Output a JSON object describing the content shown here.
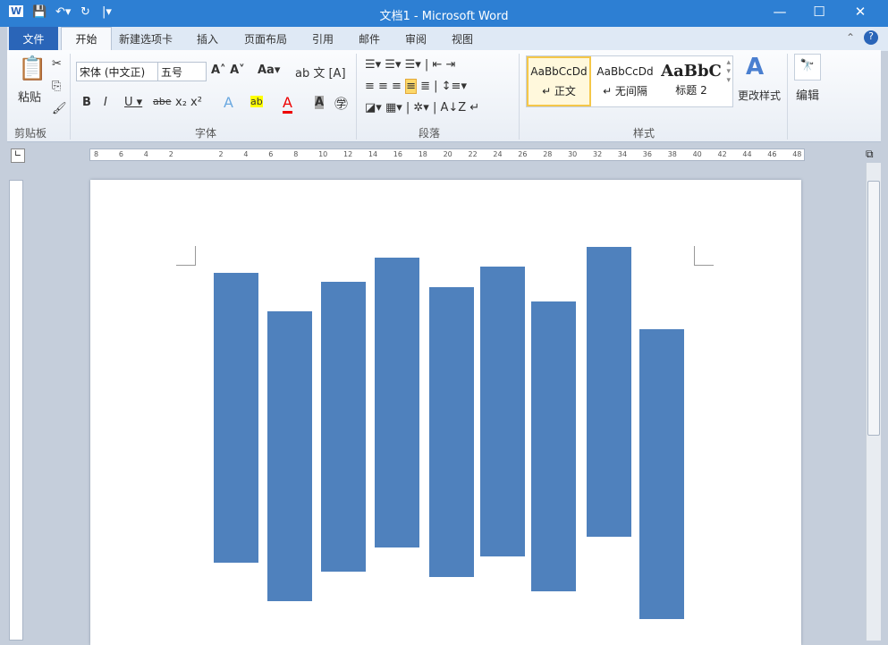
{
  "window": {
    "title": "文档1 - Microsoft Word"
  },
  "quick_access": {
    "app_icon": "word-icon",
    "save": "save-icon",
    "undo": "undo-icon",
    "redo": "redo-icon",
    "customize": "customize-dropdown-icon"
  },
  "window_controls": {
    "minimize": "—",
    "maximize": "☐",
    "close": "✕"
  },
  "tabs": [
    {
      "label": "文件"
    },
    {
      "label": "开始"
    },
    {
      "label": "新建选项卡"
    },
    {
      "label": "插入"
    },
    {
      "label": "页面布局"
    },
    {
      "label": "引用"
    },
    {
      "label": "邮件"
    },
    {
      "label": "审阅"
    },
    {
      "label": "视图"
    }
  ],
  "ribbon": {
    "clipboard": {
      "group": "剪贴板",
      "paste": "粘贴"
    },
    "font": {
      "group": "字体",
      "font_name": "宋体 (中文正)",
      "font_size": "五号"
    },
    "paragraph": {
      "group": "段落"
    },
    "styles": {
      "group": "样式",
      "items": [
        {
          "preview": "AaBbCcDd",
          "label": "↵ 正文"
        },
        {
          "preview": "AaBbCcDd",
          "label": "↵ 无间隔"
        },
        {
          "preview": "AaBbC",
          "label": "标题 2"
        }
      ],
      "change": "更改样式"
    },
    "editing": {
      "label": "编辑"
    }
  },
  "ruler": {
    "ticks": [
      "8",
      "6",
      "4",
      "2",
      "",
      "2",
      "4",
      "6",
      "8",
      "10",
      "12",
      "14",
      "16",
      "18",
      "20",
      "22",
      "24",
      "26",
      "28",
      "30",
      "32",
      "34",
      "36",
      "38",
      "40",
      "42",
      "44",
      "46",
      "48"
    ]
  },
  "colors": {
    "title_bar": "#2d7fd3",
    "shape_fill": "#4f81bd"
  }
}
